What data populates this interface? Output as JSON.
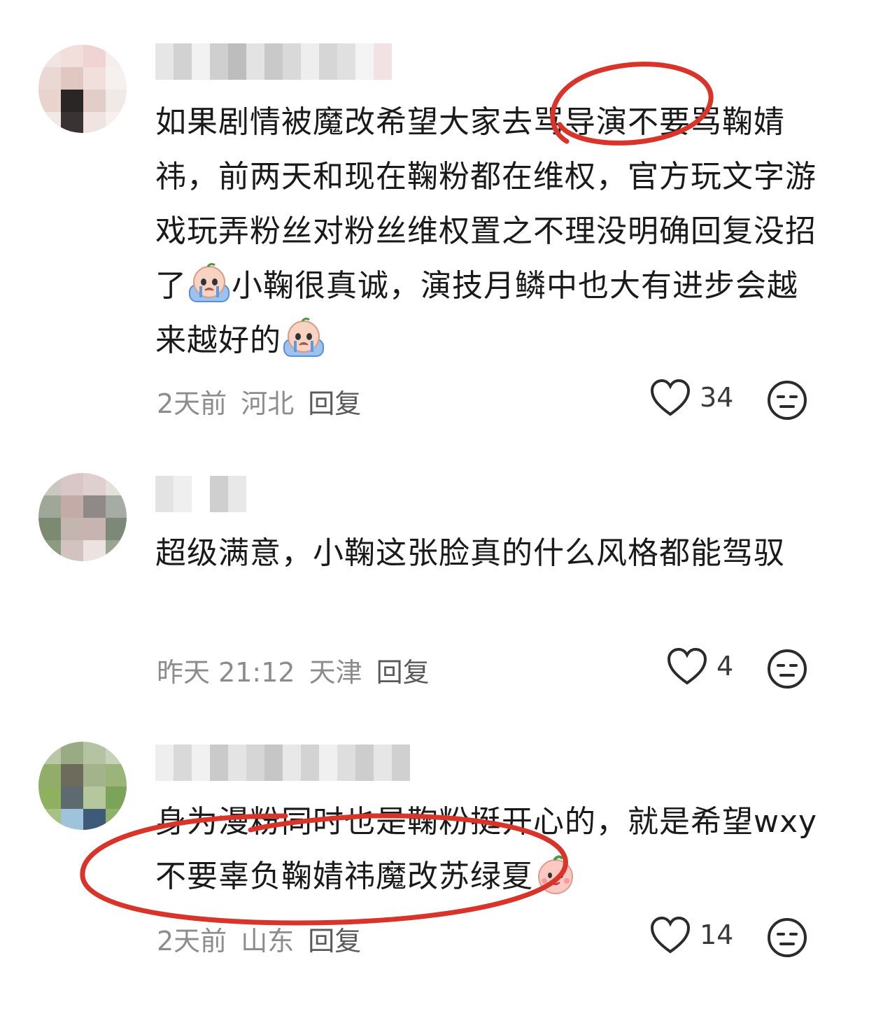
{
  "comments": [
    {
      "text_before_emoji1": "如果剧情被魔改希望大家去骂导演不要骂鞠婧祎，前两天和现在鞠粉都在维权，官方玩文字游戏玩弄粉丝对粉丝维权置之不理没明确回复没招了",
      "text_between": "小鞠很真诚，演技月鳞中也大有进步会越来越好的",
      "time": "2天前",
      "location": "河北",
      "reply_label": "回复",
      "likes": "34"
    },
    {
      "text": "超级满意，小鞠这张脸真的什么风格都能驾驭",
      "time": "昨天 21:12",
      "location": "天津",
      "reply_label": "回复",
      "likes": "4"
    },
    {
      "text": "身为漫粉同时也是鞠粉挺开心的，就是希望wxy不要辜负鞠婧祎魔改苏绿夏",
      "time": "2天前",
      "location": "山东",
      "reply_label": "回复",
      "likes": "14"
    }
  ],
  "icons": {
    "like": "heart-outline-icon",
    "dislike": "neutral-face-icon",
    "emoji_cry": "crying-face-emoji",
    "emoji_smile": "smiling-face-emoji"
  },
  "colors": {
    "annotation_red": "#d8342a",
    "meta_gray": "#8c8c8c"
  }
}
